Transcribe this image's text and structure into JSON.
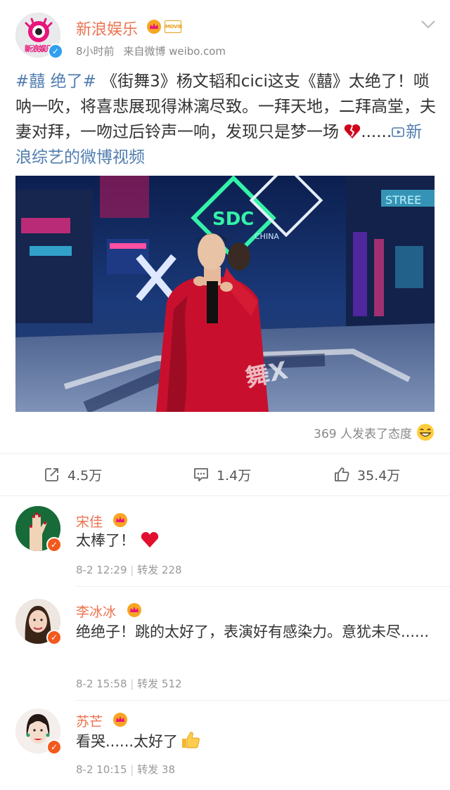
{
  "post": {
    "author": "新浪娱乐",
    "avatar_text": "新浪娱乐",
    "movie_badge": "MOVIE",
    "time": "8小时前",
    "source": "来自微博 weibo.com",
    "topic": "#囍 绝了#",
    "text_main": " 《街舞3》杨文韬和cici这支《囍》太绝了！唢呐一吹，将喜悲展现得淋漓尽致。一拜天地，二拜高堂，夫妻对拜，一吻过后铃声一响，发现只是梦一场 ",
    "ellipsis": "......",
    "video_link": "新浪综艺的微博视频",
    "attitude_text": "369 人发表了态度",
    "icons": {
      "menu": "chevron-down-icon",
      "verify": "verified-icon",
      "broken_heart": "broken-heart-icon",
      "video": "video-play-icon",
      "attitude": "grin-emoji-icon"
    }
  },
  "actions": {
    "repost": {
      "count": "4.5万",
      "icon": "repost-icon"
    },
    "comment": {
      "count": "1.4万",
      "icon": "comment-icon"
    },
    "like": {
      "count": "35.4万",
      "icon": "like-icon"
    }
  },
  "comments": [
    {
      "name": "宋佳",
      "text": "太棒了！",
      "emoji": "heart-icon",
      "date": "8-2 12:29",
      "repost_label": "转发",
      "repost_count": "228"
    },
    {
      "name": "李冰冰",
      "text": "绝绝子！跳的太好了，表演好有感染力。意犹未尽......",
      "date": "8-2 15:58",
      "repost_label": "转发",
      "repost_count": "512"
    },
    {
      "name": "苏芒",
      "text": "看哭......太好了",
      "emoji": "thumbs-up-icon",
      "date": "8-2 10:15",
      "repost_label": "转发",
      "repost_count": "38"
    }
  ],
  "colors": {
    "name": "#eb7350",
    "link": "#507daf",
    "meta": "#888888",
    "verified_blue": "#2f9ff0",
    "verified_orange": "#f25a1d"
  }
}
